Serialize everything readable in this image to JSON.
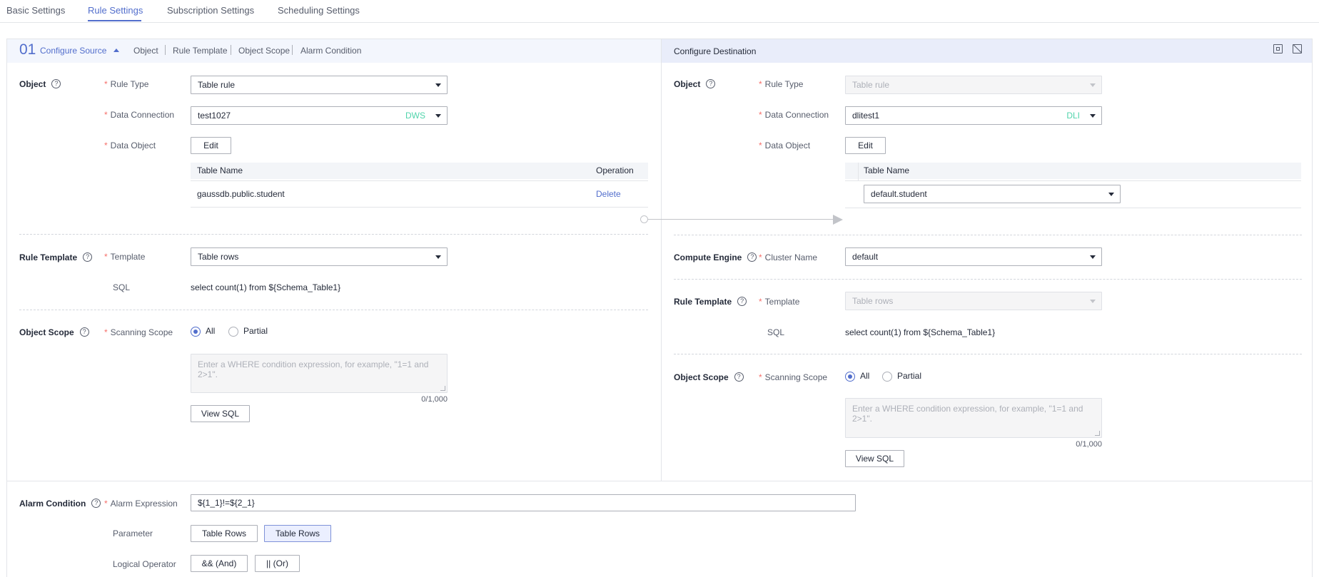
{
  "tabs": [
    "Basic Settings",
    "Rule Settings",
    "Subscription Settings",
    "Scheduling Settings"
  ],
  "source": {
    "step_number": "01",
    "title": "Configure Source",
    "anchors": [
      "Object",
      "Rule Template",
      "Object Scope",
      "Alarm Condition"
    ],
    "object_label": "Object",
    "rule_type_label": "Rule Type",
    "rule_type_value": "Table rule",
    "data_connection_label": "Data Connection",
    "data_connection_value": "test1027",
    "data_connection_tag": "DWS",
    "data_object_label": "Data Object",
    "edit_label": "Edit",
    "table": {
      "col_table_name": "Table Name",
      "col_operation": "Operation",
      "rows": [
        {
          "table_name": "gaussdb.public.student",
          "operation": "Delete"
        }
      ]
    },
    "rule_template_label": "Rule Template",
    "template_label": "Template",
    "template_value": "Table rows",
    "sql_label": "SQL",
    "sql_value": "select count(1) from ${Schema_Table1}",
    "object_scope_label": "Object Scope",
    "scanning_scope_label": "Scanning Scope",
    "scope_all": "All",
    "scope_partial": "Partial",
    "where_placeholder": "Enter a WHERE condition expression, for example, \"1=1 and 2>1\".",
    "counter": "0/1,000",
    "view_sql_label": "View SQL"
  },
  "destination": {
    "title": "Configure Destination",
    "object_label": "Object",
    "rule_type_label": "Rule Type",
    "rule_type_value": "Table rule",
    "data_connection_label": "Data Connection",
    "data_connection_value": "dlitest1",
    "data_connection_tag": "DLI",
    "data_object_label": "Data Object",
    "edit_label": "Edit",
    "table": {
      "col_table_name": "Table Name",
      "rows": [
        {
          "table_name": "default.student"
        }
      ]
    },
    "compute_engine_label": "Compute Engine",
    "cluster_name_label": "Cluster Name",
    "cluster_name_value": "default",
    "rule_template_label": "Rule Template",
    "template_label": "Template",
    "template_value": "Table rows",
    "sql_label": "SQL",
    "sql_value": "select count(1) from ${Schema_Table1}",
    "object_scope_label": "Object Scope",
    "scanning_scope_label": "Scanning Scope",
    "scope_all": "All",
    "scope_partial": "Partial",
    "where_placeholder": "Enter a WHERE condition expression, for example, \"1=1 and 2>1\".",
    "counter": "0/1,000",
    "view_sql_label": "View SQL"
  },
  "alarm": {
    "section_label": "Alarm Condition",
    "expression_label": "Alarm Expression",
    "expression_value": "${1_1}!=${2_1}",
    "parameter_label": "Parameter",
    "parameters": [
      "Table Rows",
      "Table Rows"
    ],
    "logical_operator_label": "Logical Operator",
    "operators": [
      "&& (And)",
      "|| (Or)"
    ]
  },
  "colors": {
    "accent": "#526ecc",
    "required": "#f66f6a",
    "tag": "#50d4ab"
  }
}
